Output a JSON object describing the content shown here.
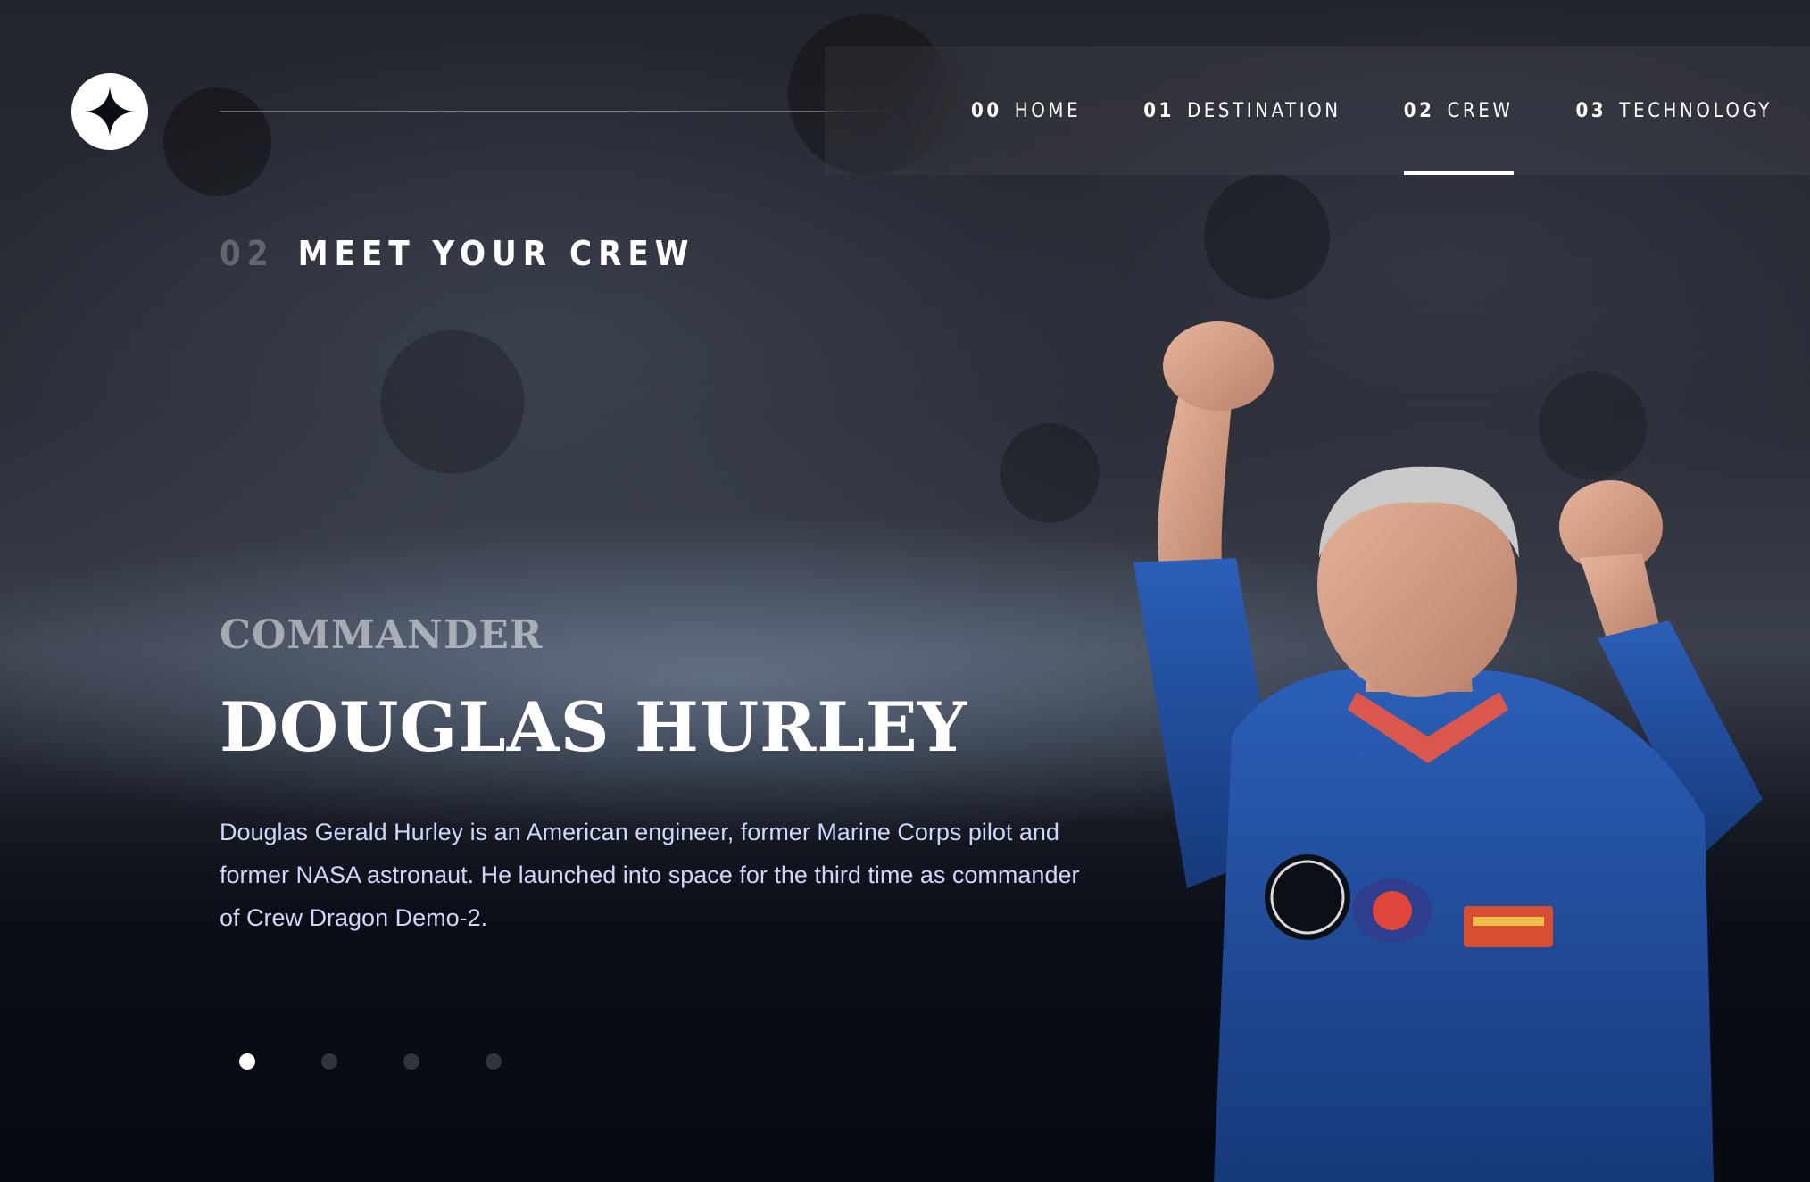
{
  "header": {
    "logo_icon": "star-logo-icon",
    "nav": [
      {
        "num": "00",
        "label": "HOME",
        "active": false
      },
      {
        "num": "01",
        "label": "DESTINATION",
        "active": false
      },
      {
        "num": "02",
        "label": "CREW",
        "active": true
      },
      {
        "num": "03",
        "label": "TECHNOLOGY",
        "active": false
      }
    ]
  },
  "page": {
    "heading_num": "02",
    "heading_text": "MEET YOUR CREW"
  },
  "crew": {
    "role": "Commander",
    "name": "Douglas Hurley",
    "bio": "Douglas Gerald Hurley is an American engineer, former Marine Corps pilot and former NASA astronaut. He launched into space for the third time as commander of Crew Dragon Demo-2.",
    "image": "astronaut-douglas-hurley"
  },
  "slider": {
    "count": 4,
    "active_index": 0
  },
  "colors": {
    "background": "#0b0d17",
    "accent_light": "#d0d6f9",
    "white": "#ffffff",
    "suit_blue": "#1f4fa3"
  }
}
